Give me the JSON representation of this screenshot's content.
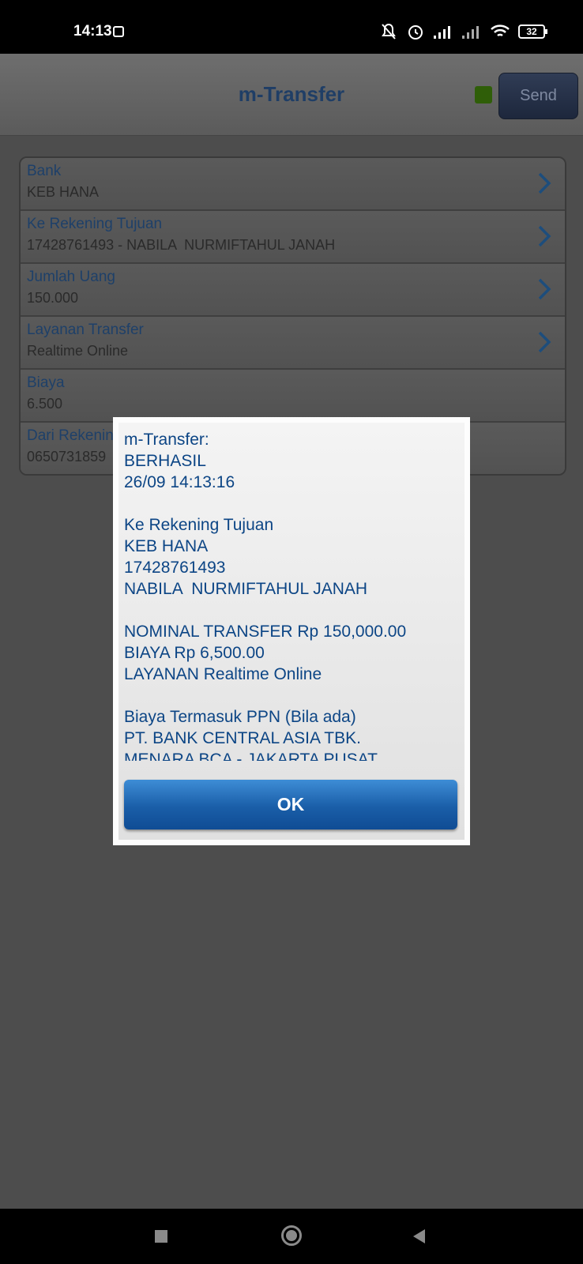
{
  "status_bar": {
    "time": "14:13",
    "battery": "32",
    "icons": [
      "notification-icon",
      "mute-icon",
      "alarm-icon",
      "signal-icon",
      "signal-icon-2",
      "wifi-icon",
      "battery-icon"
    ]
  },
  "app_bar": {
    "title": "m-Transfer",
    "send_label": "Send",
    "led_color": "#2f5e08"
  },
  "form": {
    "rows": [
      {
        "label": "Bank",
        "value": "KEB HANA"
      },
      {
        "label": "Ke Rekening Tujuan",
        "value": "17428761493 - NABILA  NURMIFTAHUL JANAH"
      },
      {
        "label": "Jumlah Uang",
        "value": "150.000"
      },
      {
        "label": "Layanan Transfer",
        "value": "Realtime Online"
      },
      {
        "label": "Biaya",
        "value": "6.500"
      },
      {
        "label": "Dari Rekening",
        "value": "0650731859"
      }
    ]
  },
  "dialog": {
    "message": "m-Transfer:\nBERHASIL\n26/09 14:13:16\n\nKe Rekening Tujuan\nKEB HANA\n17428761493\nNABILA  NURMIFTAHUL JANAH\n\nNOMINAL TRANSFER Rp 150,000.00\nBIAYA Rp 6,500.00\nLAYANAN Realtime Online\n\nBiaya Termasuk PPN (Bila ada)\nPT. BANK CENTRAL ASIA TBK.\nMENARA BCA - JAKARTA PUSAT",
    "ok_label": "OK"
  },
  "colors": {
    "accent": "#0c4585",
    "ok_button": "#1a5ea8"
  }
}
